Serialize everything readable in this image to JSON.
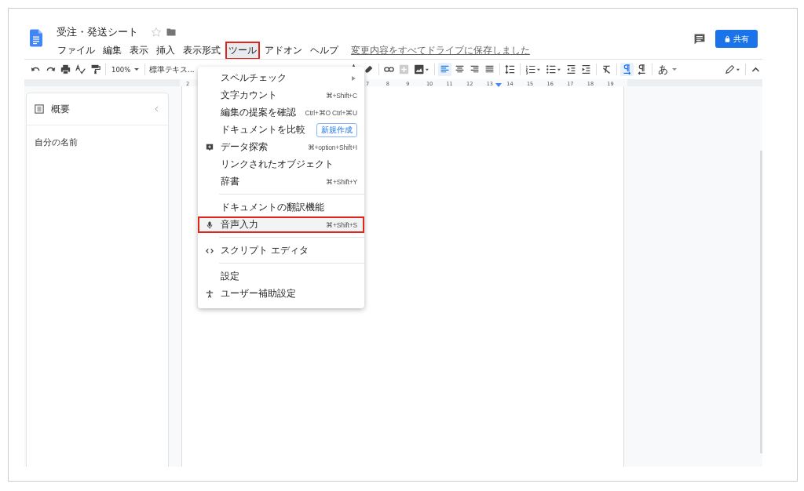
{
  "document": {
    "title": "受注・発送シート",
    "starred": false,
    "save_status": "変更内容をすべてドライブに保存しました"
  },
  "menubar": [
    {
      "label": "ファイル",
      "selected": false,
      "annotated": false
    },
    {
      "label": "編集",
      "selected": false,
      "annotated": false
    },
    {
      "label": "表示",
      "selected": false,
      "annotated": false
    },
    {
      "label": "挿入",
      "selected": false,
      "annotated": false
    },
    {
      "label": "表示形式",
      "selected": false,
      "annotated": false
    },
    {
      "label": "ツール",
      "selected": true,
      "annotated": true
    },
    {
      "label": "アドオン",
      "selected": false,
      "annotated": false
    },
    {
      "label": "ヘルプ",
      "selected": false,
      "annotated": false
    }
  ],
  "share_button": {
    "label": "共有"
  },
  "toolbar": {
    "zoom": "100%",
    "style": "標準テキス...",
    "input_tool": "あ",
    "align_left": {
      "selected": true
    },
    "ltr": {
      "selected": true
    }
  },
  "ruler": {
    "left_ticks": [
      "2"
    ],
    "right_ticks": [
      "7",
      "8",
      "9",
      "10",
      "11",
      "12",
      "13",
      "14",
      "15",
      "16",
      "17",
      "18",
      "19"
    ]
  },
  "outline": {
    "title": "概要",
    "items": [
      "自分の名前"
    ]
  },
  "tools_menu": [
    {
      "kind": "submenu",
      "label": "スペルチェック",
      "annotated": false
    },
    {
      "kind": "plain",
      "label": "文字カウント",
      "shortcut": "⌘+Shift+C",
      "annotated": false
    },
    {
      "kind": "plain",
      "label": "編集の提案を確認",
      "shortcut": "Ctrl+⌘O Ctrl+⌘U",
      "annotated": false
    },
    {
      "kind": "badge",
      "label": "ドキュメントを比較",
      "badge": "新規作成",
      "annotated": false
    },
    {
      "kind": "explore",
      "label": "データ探索",
      "shortcut": "⌘+option+Shift+I",
      "annotated": false
    },
    {
      "kind": "plain",
      "label": "リンクされたオブジェクト",
      "annotated": false
    },
    {
      "kind": "plain",
      "label": "辞書",
      "shortcut": "⌘+Shift+Y",
      "annotated": false
    },
    {
      "kind": "separator"
    },
    {
      "kind": "plain",
      "label": "ドキュメントの翻訳機能",
      "annotated": false
    },
    {
      "kind": "voice",
      "label": "音声入力",
      "shortcut": "⌘+Shift+S",
      "annotated": true
    },
    {
      "kind": "separator"
    },
    {
      "kind": "script",
      "label": "スクリプト エディタ",
      "annotated": false
    },
    {
      "kind": "separator"
    },
    {
      "kind": "plain",
      "label": "設定",
      "annotated": false
    },
    {
      "kind": "access",
      "label": "ユーザー補助設定",
      "annotated": false
    }
  ]
}
